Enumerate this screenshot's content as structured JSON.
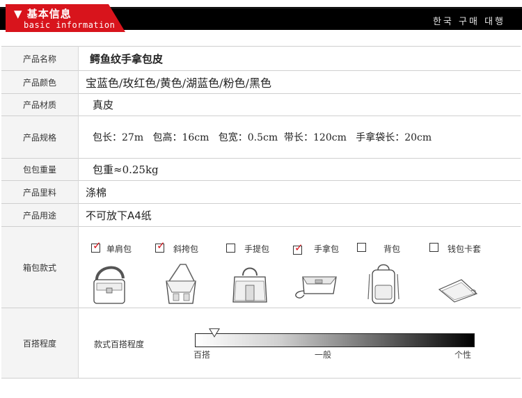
{
  "header": {
    "title_cn": "▼ 基本信息",
    "title_en": "basic information",
    "korean": "한국 구매 대행"
  },
  "rows": {
    "name": {
      "label": "产品名称",
      "value": "鳄鱼纹手拿包皮"
    },
    "color": {
      "label": "产品颜色",
      "value": "宝蓝色/玫红色/黄色/湖蓝色/粉色/黑色"
    },
    "material": {
      "label": "产品材质",
      "value": "真皮"
    },
    "size": {
      "label": "产品规格",
      "value": "包长：27m   包高：16cm   包宽：0.5cm  带长：120cm   手拿袋长：20cm"
    },
    "weight": {
      "label": "包包重量",
      "value": "包重≈0.25kg"
    },
    "lining": {
      "label": "产品里料",
      "value": "涤棉"
    },
    "usage": {
      "label": "产品用途",
      "value": "不可放下A4纸"
    }
  },
  "styles": {
    "label": "箱包款式",
    "items": [
      {
        "name": "单肩包",
        "checked": true,
        "icon": "shoulder-bag-icon"
      },
      {
        "name": "斜挎包",
        "checked": true,
        "icon": "crossbody-bag-icon"
      },
      {
        "name": "手提包",
        "checked": false,
        "icon": "handbag-icon"
      },
      {
        "name": "手拿包",
        "checked": true,
        "icon": "clutch-bag-icon"
      },
      {
        "name": "背包",
        "checked": false,
        "icon": "backpack-icon"
      },
      {
        "name": "钱包卡套",
        "checked": false,
        "icon": "wallet-icon"
      }
    ]
  },
  "matching": {
    "label": "百搭程度",
    "caption": "款式百搭程度",
    "ticks": [
      "百搭",
      "一般",
      "个性"
    ],
    "level": 0.07
  },
  "colors": {
    "accent": "#d8141c",
    "header_bg": "#000000",
    "label_bg": "#f4f4f4"
  }
}
